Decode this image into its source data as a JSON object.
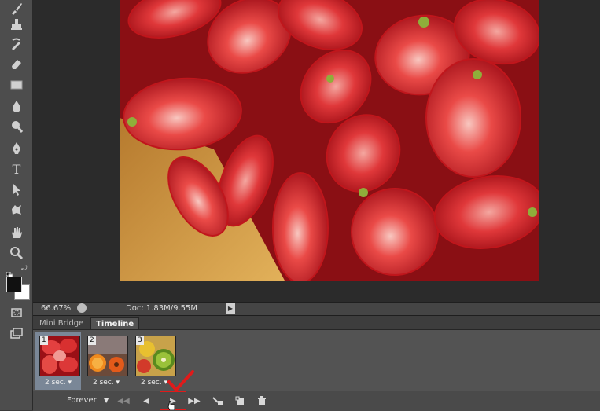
{
  "tools": [
    {
      "name": "brush-tool-icon"
    },
    {
      "name": "clone-stamp-tool-icon"
    },
    {
      "name": "history-brush-tool-icon"
    },
    {
      "name": "eraser-tool-icon"
    },
    {
      "name": "gradient-tool-icon"
    },
    {
      "name": "blur-tool-icon"
    },
    {
      "name": "dodge-tool-icon"
    },
    {
      "name": "pen-tool-icon"
    },
    {
      "name": "type-tool-icon",
      "glyph": "T"
    },
    {
      "name": "path-selection-tool-icon"
    },
    {
      "name": "custom-shape-tool-icon"
    },
    {
      "name": "hand-tool-icon"
    },
    {
      "name": "zoom-tool-icon"
    }
  ],
  "status": {
    "zoom": "66.67%",
    "doc": "Doc: 1.83M/9.55M"
  },
  "panel_tabs": {
    "mini_bridge": "Mini Bridge",
    "timeline": "Timeline"
  },
  "frames": [
    {
      "number": "1",
      "delay": "2 sec.",
      "selected": true,
      "image": "strawberries"
    },
    {
      "number": "2",
      "delay": "2 sec.",
      "selected": false,
      "image": "oranges-and-gerbera"
    },
    {
      "number": "3",
      "delay": "2 sec.",
      "selected": false,
      "image": "kiwi-and-fruit"
    }
  ],
  "controls": {
    "loop": "Forever"
  },
  "colors": {
    "annotation_red": "#e01a1a",
    "selected_frame": "#7a8797"
  }
}
